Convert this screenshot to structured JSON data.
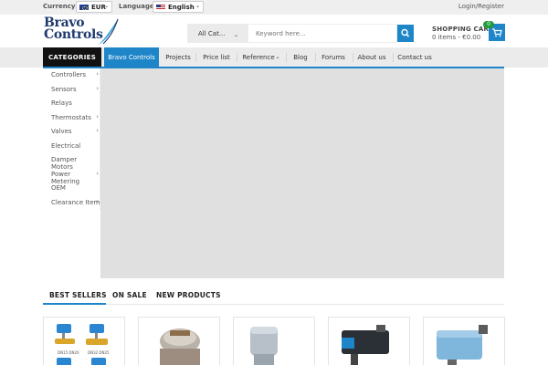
{
  "topbar": {
    "currency_label": "Currency:",
    "currency_value": "EUR",
    "language_label": "Language:",
    "language_value": "English",
    "login_register": "Login/Register"
  },
  "logo": {
    "line1": "Bravo",
    "line2": "Controls"
  },
  "search": {
    "category": "All Cat...",
    "placeholder": "Keyword here..."
  },
  "cart": {
    "title": "SHOPPING CART",
    "summary": "0 items - €0.00",
    "count": "0"
  },
  "nav": {
    "categories": "CATEGORIES",
    "items": [
      "Bravo Controls",
      "Projects",
      "Price list",
      "Reference",
      "Blog",
      "Forums",
      "About us",
      "Contact us"
    ],
    "reference_caret": "⌄"
  },
  "sidebar": {
    "items": [
      {
        "label": "Controllers",
        "arrow": "›"
      },
      {
        "label": "Sensors",
        "arrow": "›"
      },
      {
        "label": "Relays",
        "arrow": ""
      },
      {
        "label": "Thermostats",
        "arrow": "›"
      },
      {
        "label": "Valves",
        "arrow": "›"
      },
      {
        "label": "Electrical",
        "arrow": ""
      },
      {
        "label": "Damper Motors",
        "arrow": ""
      },
      {
        "label": "Power Metering",
        "arrow": "›"
      },
      {
        "label": "OEM",
        "arrow": ""
      },
      {
        "label": "Clearance Item",
        "arrow": "›"
      }
    ]
  },
  "tabs": [
    "BEST SELLERS",
    "ON SALE",
    "NEW PRODUCTS"
  ],
  "products": [
    {
      "caption_left": "DN15 DN20",
      "caption_right": "DN32 DN25"
    },
    {},
    {},
    {},
    {}
  ],
  "colors": {
    "accent": "#1e86c8",
    "nav_category_bg": "#111111",
    "badge": "#1f9c3d",
    "slider_bg": "#e0e0e0"
  }
}
